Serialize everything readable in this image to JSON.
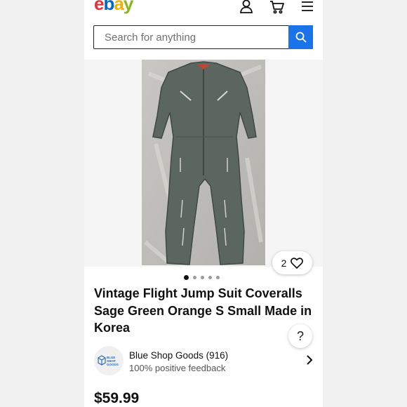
{
  "header": {
    "logo_letters": [
      "e",
      "b",
      "a",
      "y"
    ],
    "logo_colors": [
      "#e53238",
      "#0064d2",
      "#f5af02",
      "#86b817"
    ],
    "icons": [
      "user-icon",
      "cart-icon",
      "menu-icon"
    ]
  },
  "search": {
    "placeholder": "Search for anything",
    "value": "",
    "button_icon": "search-icon"
  },
  "gallery": {
    "like_count": "2",
    "dot_count": 5,
    "active_dot": 0
  },
  "listing": {
    "title": "Vintage Flight Jump Suit Coveralls Sage Green Orange S Small Made in Korea",
    "price": "$59.99"
  },
  "seller": {
    "logo_text": [
      "BLUE",
      "SHOP",
      "GOODS"
    ],
    "name": "Blue Shop Goods (916)",
    "feedback": "100% positive feedback"
  },
  "help_label": "?",
  "colors": {
    "accent": "#1a73e8",
    "text": "#111111"
  }
}
